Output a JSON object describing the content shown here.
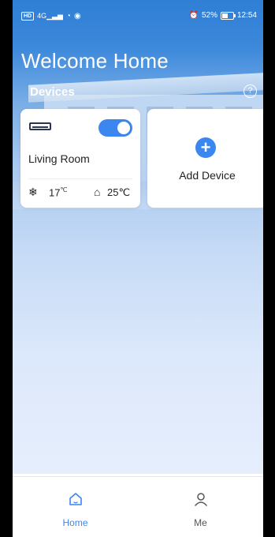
{
  "status_bar": {
    "network_badge": "HD",
    "signal_text": "4G",
    "battery": "52%",
    "time": "12:54"
  },
  "header": {
    "welcome": "Welcome Home",
    "section_title": "Devices",
    "help": "?"
  },
  "devices": [
    {
      "name": "Living Room",
      "icon": "air-conditioner-icon",
      "power_on": true,
      "set_temp": "17",
      "set_temp_unit": "℃",
      "room_temp": "25℃"
    }
  ],
  "add_device": {
    "label": "Add Device",
    "icon": "plus-icon"
  },
  "tabs": [
    {
      "label": "Home",
      "icon": "home-icon",
      "active": true
    },
    {
      "label": "Me",
      "icon": "person-icon",
      "active": false
    }
  ],
  "colors": {
    "accent": "#3c86f0",
    "header_blue": "#2f7fd6"
  }
}
